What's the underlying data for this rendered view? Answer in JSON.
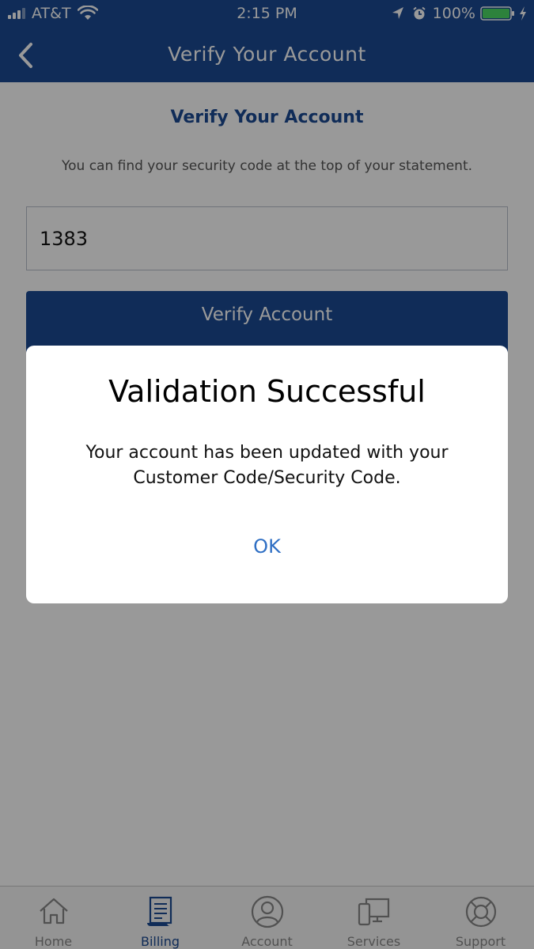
{
  "status_bar": {
    "carrier": "AT&T",
    "time": "2:15 PM",
    "battery": "100%",
    "icons": [
      "signal-icon",
      "wifi-icon",
      "location-icon",
      "alarm-icon",
      "battery-icon",
      "charging-icon"
    ]
  },
  "nav": {
    "title": "Verify Your Account",
    "back_icon": "back-chevron-icon"
  },
  "content": {
    "title": "Verify Your Account",
    "hint": "You can find your security code at the top of your statement.",
    "code_value": "1383",
    "verify_button": "Verify Account"
  },
  "alert": {
    "title": "Validation Successful",
    "message": "Your account has been updated with your Customer Code/Security Code.",
    "ok_label": "OK"
  },
  "tabs": [
    {
      "label": "Home",
      "icon": "home-icon",
      "active": false
    },
    {
      "label": "Billing",
      "icon": "billing-icon",
      "active": true
    },
    {
      "label": "Account",
      "icon": "account-icon",
      "active": false
    },
    {
      "label": "Services",
      "icon": "devices-icon",
      "active": false
    },
    {
      "label": "Support",
      "icon": "lifebuoy-icon",
      "active": false
    }
  ],
  "colors": {
    "brand": "#1b4a93",
    "link": "#2f6fc4",
    "tab_inactive": "#888888",
    "battery": "#4cd964"
  }
}
